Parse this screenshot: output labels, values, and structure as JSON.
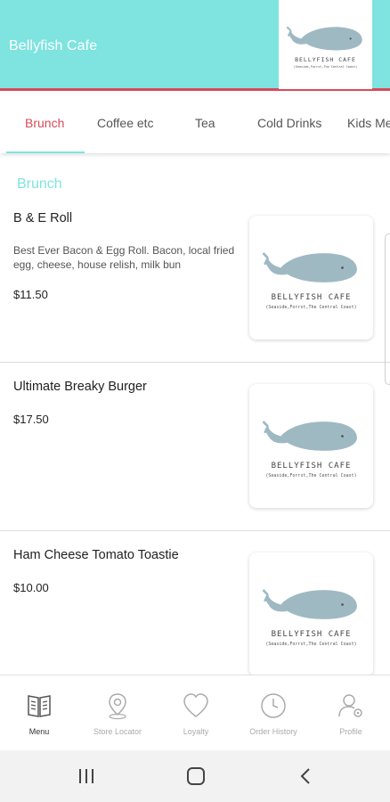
{
  "header": {
    "title": "Bellyfish Cafe",
    "logo_brand": "BELLYFISH CAFE",
    "logo_tagline": "(Seaside,Forrst,The Central Coast)"
  },
  "tabs": [
    {
      "label": "Brunch",
      "active": true
    },
    {
      "label": "Coffee etc",
      "active": false
    },
    {
      "label": "Tea",
      "active": false
    },
    {
      "label": "Cold Drinks",
      "active": false
    },
    {
      "label": "Kids Me",
      "active": false
    }
  ],
  "section": {
    "title": "Brunch"
  },
  "items": [
    {
      "name": "B & E Roll",
      "description": "Best Ever Bacon & Egg Roll. Bacon, local fried egg, cheese, house relish, milk bun",
      "price": "$11.50"
    },
    {
      "name": "Ultimate Breaky Burger",
      "description": "",
      "price": "$17.50"
    },
    {
      "name": "Ham Cheese Tomato Toastie",
      "description": "",
      "price": "$10.00"
    }
  ],
  "bottom_nav": [
    {
      "label": "Menu",
      "icon": "menu-book-icon",
      "active": true
    },
    {
      "label": "Store Locator",
      "icon": "location-pin-icon",
      "active": false
    },
    {
      "label": "Loyalty",
      "icon": "heart-icon",
      "active": false
    },
    {
      "label": "Order History",
      "icon": "clock-icon",
      "active": false
    },
    {
      "label": "Profile",
      "icon": "profile-gear-icon",
      "active": false
    }
  ],
  "system_nav": {
    "recents_icon": "recent-apps-icon",
    "home_icon": "home-icon",
    "back_icon": "back-icon"
  },
  "colors": {
    "accent": "#7fe3e0",
    "active_tab": "#d94a5a",
    "whale": "#9fb9c3"
  }
}
